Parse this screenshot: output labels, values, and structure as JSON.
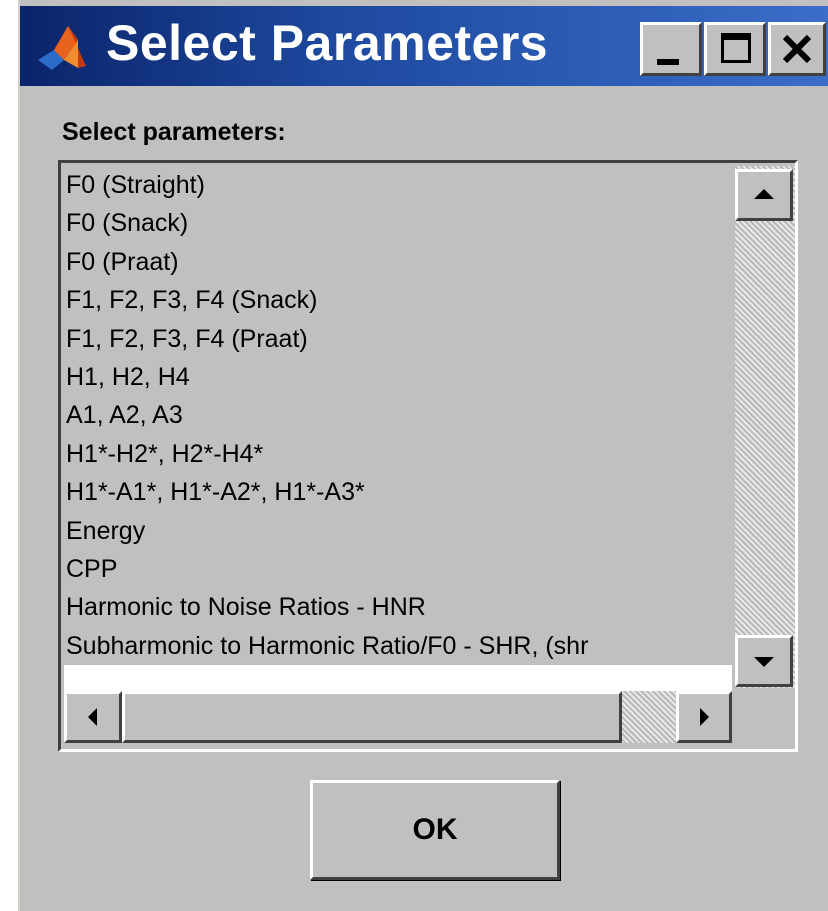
{
  "window": {
    "title": "Select Parameters",
    "icon": "matlab-logo-icon",
    "controls": {
      "minimize": "minimize-icon",
      "maximize": "maximize-icon",
      "close": "close-icon"
    }
  },
  "prompt": "Select parameters:",
  "list": {
    "items": [
      "F0 (Straight)",
      "F0 (Snack)",
      "F0 (Praat)",
      "F1, F2, F3, F4 (Snack)",
      "F1, F2, F3, F4 (Praat)",
      "H1, H2, H4",
      "A1, A2, A3",
      "H1*-H2*, H2*-H4*",
      "H1*-A1*, H1*-A2*, H1*-A3*",
      "Energy",
      "CPP",
      "Harmonic to Noise Ratios - HNR",
      "Subharmonic to Harmonic Ratio/F0 - SHR, (shr"
    ]
  },
  "ok_button": {
    "label": "OK"
  },
  "colors": {
    "title_bar": "#0a246a",
    "dialog_bg": "#c0c0c0"
  }
}
